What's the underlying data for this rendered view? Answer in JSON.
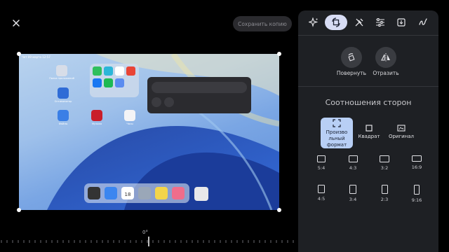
{
  "header": {
    "save_label": "Сохранить копию"
  },
  "photo": {
    "status_time": "Чет 09 марта 12:57",
    "icons": [
      "Папка приложений",
      "Оптимизатор",
      "Файлы",
      "Музыка",
      "Часы"
    ],
    "dock_day": "18"
  },
  "ruler": {
    "angle": "0°"
  },
  "panel": {
    "tabs": [
      "sparkle-icon",
      "crop-rotate-icon",
      "tools-icon",
      "tune-icon",
      "export-icon",
      "markup-icon"
    ],
    "rotate_label": "Повернуть",
    "flip_label": "Отразить",
    "aspect_title": "Соотношения сторон",
    "free_label": "Произво льный формат",
    "square_label": "Квадрат",
    "original_label": "Оригинал",
    "ratios_row1": [
      "5:4",
      "4:3",
      "3:2",
      "16:9"
    ],
    "ratios_row2": [
      "4:5",
      "3:4",
      "2:3",
      "9:16"
    ]
  }
}
